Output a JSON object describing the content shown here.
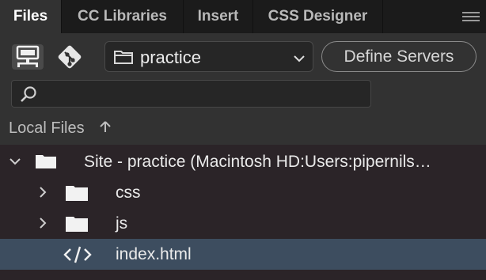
{
  "tabs": [
    {
      "label": "Files",
      "active": true
    },
    {
      "label": "CC Libraries",
      "active": false
    },
    {
      "label": "Insert",
      "active": false
    },
    {
      "label": "CSS Designer",
      "active": false
    }
  ],
  "toolbar": {
    "site_name": "practice",
    "define_servers_label": "Define Servers",
    "search_placeholder": ""
  },
  "section": {
    "title": "Local Files",
    "sort_arrow": "↑"
  },
  "tree": [
    {
      "name": "Site - practice (Macintosh HD:Users:pipernils…",
      "type": "site-root",
      "expanded": true
    },
    {
      "name": "css",
      "type": "folder",
      "expanded": false
    },
    {
      "name": "js",
      "type": "folder",
      "expanded": false
    },
    {
      "name": "index.html",
      "type": "html-file",
      "selected": true
    }
  ],
  "colors": {
    "selected_row": "#3d4d5f",
    "tree_background": "#2b2428",
    "panel_background": "#323232"
  }
}
